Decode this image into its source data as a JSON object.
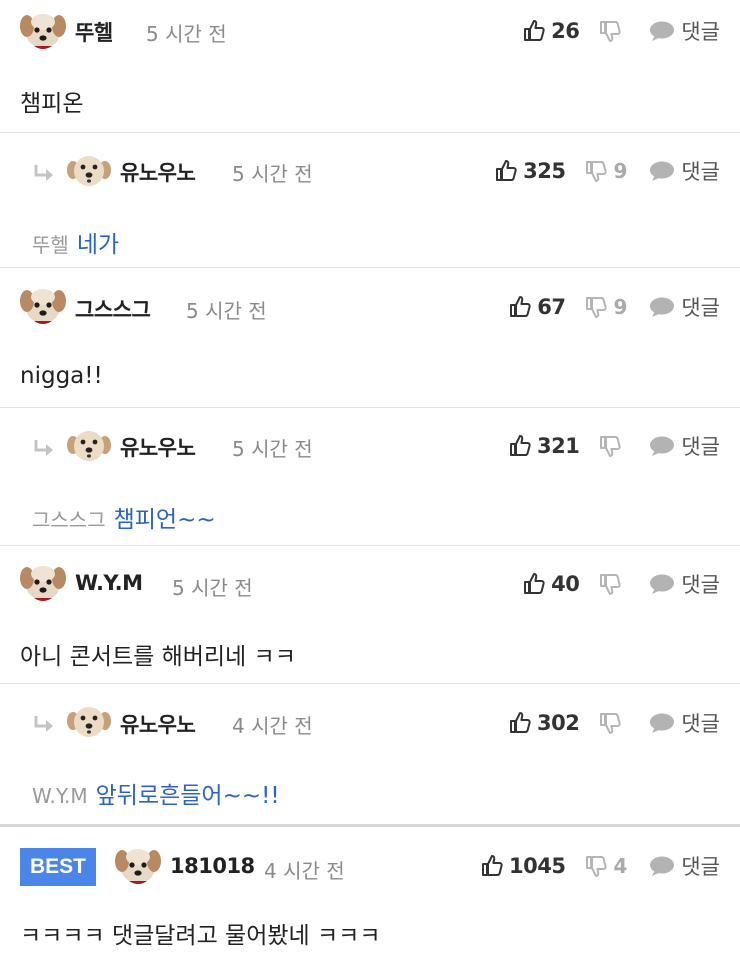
{
  "labels": {
    "reply_button": "댓글",
    "best_badge": "BEST"
  },
  "comments": [
    {
      "nick": "뚜헬",
      "time": "5 시간 전",
      "likes": "26",
      "dislikes": "",
      "text": "챔피온"
    },
    {
      "nick": "유노우노",
      "time": "5 시간 전",
      "likes": "325",
      "dislikes": "9",
      "mention": "뚜헬",
      "text": "네가"
    },
    {
      "nick": "그스스그",
      "time": "5 시간 전",
      "likes": "67",
      "dislikes": "9",
      "text": "nigga!!"
    },
    {
      "nick": "유노우노",
      "time": "5 시간 전",
      "likes": "321",
      "dislikes": "",
      "mention": "그스스그",
      "text": "챔피언~~"
    },
    {
      "nick": "W.Y.M",
      "time": "5 시간 전",
      "likes": "40",
      "dislikes": "",
      "text": "아니 콘서트를 해버리네 ㅋㅋ"
    },
    {
      "nick": "유노우노",
      "time": "4 시간 전",
      "likes": "302",
      "dislikes": "",
      "mention": "W.Y.M",
      "text": "앞뒤로흔들어~~!!"
    },
    {
      "nick": "181018",
      "time": "4 시간 전",
      "likes": "1045",
      "dislikes": "4",
      "text": "ㅋㅋㅋㅋ 댓글달려고 물어봤네 ㅋㅋㅋ"
    }
  ]
}
